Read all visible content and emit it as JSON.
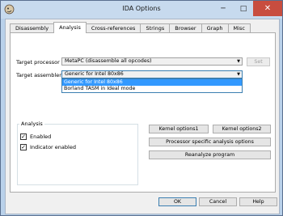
{
  "window": {
    "title": "IDA Options",
    "minimize": "─",
    "maximize": "□",
    "close": "✕",
    "icon": "ida-app-icon"
  },
  "tabs": [
    {
      "label": "Disassembly",
      "active": false
    },
    {
      "label": "Analysis",
      "active": true
    },
    {
      "label": "Cross-references",
      "active": false
    },
    {
      "label": "Strings",
      "active": false
    },
    {
      "label": "Browser",
      "active": false
    },
    {
      "label": "Graph",
      "active": false
    },
    {
      "label": "Misc",
      "active": false
    }
  ],
  "target_processor": {
    "label": "Target processor",
    "value": "MetaPC (disassemble all opcodes)",
    "set_button": "Set"
  },
  "target_assembler": {
    "label": "Target assembler",
    "value": "Generic for Intel 80x86",
    "options": [
      "Generic for Intel 80x86",
      "Borland TASM in Ideal mode"
    ],
    "selected_index": 0
  },
  "analysis_group": {
    "title": "Analysis",
    "enabled": {
      "label": "Enabled",
      "checked": true
    },
    "indicator": {
      "label": "Indicator enabled",
      "checked": true
    }
  },
  "buttons": {
    "kernel_options1": "Kernel options1",
    "kernel_options2": "Kernel options2",
    "processor_specific": "Processor specific analysis options",
    "reanalyze": "Reanalyze program",
    "ok": "OK",
    "cancel": "Cancel",
    "help": "Help"
  },
  "check_mark": "✓",
  "dropdown_arrow": "▼",
  "colors": {
    "selection": "#3399ff",
    "titlebar": "#c7daee",
    "close": "#c84d3f"
  }
}
